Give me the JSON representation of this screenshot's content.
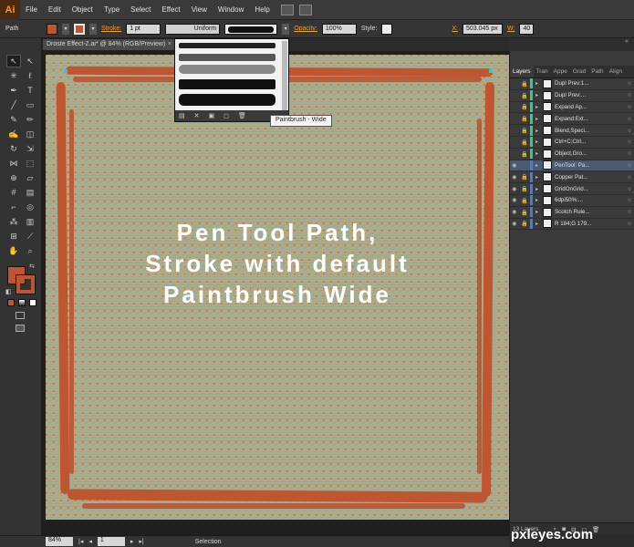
{
  "app": {
    "logo": "Ai"
  },
  "menu": [
    "File",
    "Edit",
    "Object",
    "Type",
    "Select",
    "Effect",
    "View",
    "Window",
    "Help"
  ],
  "control_bar": {
    "object_type": "Path",
    "stroke_label": "Stroke:",
    "stroke_weight": "1 pt",
    "profile": "Uniform",
    "opacity_label": "Opacity:",
    "opacity": "100%",
    "style_label": "Style:",
    "x_label": "X:",
    "x_value": "503.045 px",
    "w_label": "W:",
    "w_value": "40",
    "fill_color": "#c05630",
    "stroke_color": "#c05630"
  },
  "document": {
    "tab_title": "Droste Effect-2.ai* @ 84% (RGB/Preview)",
    "close_glyph": "×"
  },
  "brush_dropdown": {
    "tooltip": "Paintbrush - Wide"
  },
  "canvas": {
    "overlay_lines": [
      "Pen Tool Path,",
      "Stroke with default",
      "Paintbrush Wide"
    ],
    "stroke_color": "#c05630"
  },
  "tools": {
    "icons": [
      "selection-icon",
      "direct-selection-icon",
      "magic-wand-icon",
      "lasso-icon",
      "pen-icon",
      "type-icon",
      "line-icon",
      "rectangle-icon",
      "paintbrush-icon",
      "pencil-icon",
      "blob-brush-icon",
      "eraser-icon",
      "rotate-icon",
      "scale-icon",
      "width-icon",
      "free-transform-icon",
      "shape-builder-icon",
      "perspective-icon",
      "mesh-icon",
      "gradient-icon",
      "eyedropper-icon",
      "blend-icon",
      "symbol-sprayer-icon",
      "column-graph-icon",
      "artboard-icon",
      "slice-icon",
      "hand-icon",
      "zoom-icon"
    ]
  },
  "layers_panel": {
    "tabs": [
      "Layers",
      "Tran",
      "Appe",
      "Grad",
      "Path",
      "Align"
    ],
    "active_tab": "Layers",
    "layers": [
      {
        "name": "Dupl Prev:1...",
        "locked": true,
        "visible": false,
        "selected": false,
        "color": "#33cc88"
      },
      {
        "name": "Dupl Prev:...",
        "locked": true,
        "visible": false,
        "selected": false,
        "color": "#33cc88"
      },
      {
        "name": "Expand Ap...",
        "locked": true,
        "visible": false,
        "selected": false,
        "color": "#33cc88"
      },
      {
        "name": "Expand:Ext...",
        "locked": true,
        "visible": false,
        "selected": false,
        "color": "#33cc88"
      },
      {
        "name": "Blend,Speci...",
        "locked": true,
        "visible": false,
        "selected": false,
        "color": "#33cc88"
      },
      {
        "name": "Ctrl+C;Ctrl...",
        "locked": true,
        "visible": false,
        "selected": false,
        "color": "#33cc88"
      },
      {
        "name": "Object,Gro...",
        "locked": true,
        "visible": false,
        "selected": false,
        "color": "#33cc88"
      },
      {
        "name": "PenTool: Pa...",
        "locked": false,
        "visible": true,
        "selected": true,
        "color": "#3f7fd8"
      },
      {
        "name": "Copper Pat...",
        "locked": true,
        "visible": true,
        "selected": false,
        "color": "#3f7fd8"
      },
      {
        "name": "GridOnGrid...",
        "locked": true,
        "visible": true,
        "selected": false,
        "color": "#3f7fd8"
      },
      {
        "name": "6dpi50%:...",
        "locked": true,
        "visible": true,
        "selected": false,
        "color": "#3f7fd8"
      },
      {
        "name": "Scotch Rule...",
        "locked": true,
        "visible": true,
        "selected": false,
        "color": "#3f7fd8"
      },
      {
        "name": "R 184;G 179...",
        "locked": true,
        "visible": true,
        "selected": false,
        "color": "#3f7fd8"
      }
    ],
    "count_label": "13 Layers"
  },
  "status_bar": {
    "zoom": "84%",
    "page": "1",
    "mode": "Selection"
  },
  "watermark": "pxleyes.com"
}
